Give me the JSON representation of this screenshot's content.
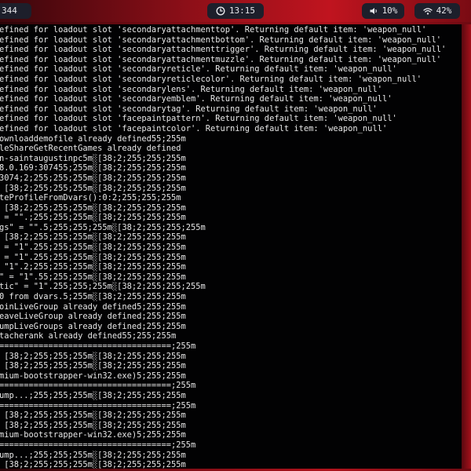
{
  "statusbar": {
    "workspace_label": "344",
    "clock_text": "13:15",
    "battery_text": "10%",
    "wifi_text": "42%",
    "icons": {
      "clock": "clock-icon",
      "battery": "speaker-icon",
      "wifi": "wifi-icon"
    },
    "colors": {
      "bar_red": "#b0121c",
      "pill_bg": "#1d1f2b",
      "terminal_bg": "#020203",
      "terminal_fg": "#e8e8e8"
    }
  },
  "terminal": {
    "lines": [
      "efined for loadout slot 'secondaryattachmenttop'. Returning default item: 'weapon_null'",
      "efined for loadout slot 'secondaryattachmentbottom'. Returning default item: 'weapon_null'",
      "efined for loadout slot 'secondaryattachmenttrigger'. Returning default item: 'weapon_null'",
      "efined for loadout slot 'secondaryattachmentmuzzle'. Returning default item: 'weapon_null'",
      "efined for loadout slot 'secondaryreticle'. Returning default item: 'weapon_null'",
      "efined for loadout slot 'secondaryreticlecolor'. Returning default item: 'weapon_null'",
      "efined for loadout slot 'secondarylens'. Returning default item: 'weapon_null'",
      "efined for loadout slot 'secondaryemblem'. Returning default item: 'weapon_null'",
      "efined for loadout slot 'secondarytag'. Returning default item: 'weapon_null'",
      "efined for loadout slot 'facepaintpattern'. Returning default item: 'weapon_null'",
      "efined for loadout slot 'facepaintcolor'. Returning default item: 'weapon_null'",
      "ownloaddemofile already defined55;255m",
      "leShareGetRecentGames already defined",
      "n-saintaugustinpc5m░[38;2;255;255;255m",
      "8.0.169:307455;255m░[38;2;255;255;255m",
      "3074;2;255;255;255m░[38;2;255;255;255m",
      " [38;2;255;255;255m░[38;2;255;255;255m",
      "teProfileFromDvars():0:2;255;255;255m",
      " [38;2;255;255;255m░[38;2;255;255;255m",
      " = \"\".;255;255;255m░[38;2;255;255;255m",
      "gs\" = \"\".5;255;255;255m░[38;2;255;255;255m",
      " [38;2;255;255;255m░[38;2;255;255;255m",
      " = \"1\".255;255;255m░[38;2;255;255;255m",
      " = \"1\".255;255;255m░[38;2;255;255;255m",
      " \"1\".2;255;255;255m░[38;2;255;255;255m",
      "\" = \"1\".55;255;255m░[38;2;255;255;255m",
      "tic\" = \"1\".255;255;255m░[38;2;255;255;255m",
      "0 from dvars.5;255m░[38;2;255;255;255m",
      "oinLiveGroup already defined5;255;255m",
      "eaveLiveGroup already defined;255;255m",
      "umpLiveGroups already defined;255;255m",
      "tacherank already defined55;255;255m",
      "===================================;255m",
      " [38;2;255;255;255m░[38;2;255;255;255m",
      " [38;2;255;255;255m░[38;2;255;255;255m",
      "mium-bootstrapper-win32.exe)5;255;255m",
      "===================================;255m",
      "ump...;255;255;255m░[38;2;255;255;255m",
      "===================================;255m",
      " [38;2;255;255;255m░[38;2;255;255;255m",
      " [38;2;255;255;255m░[38;2;255;255;255m",
      "mium-bootstrapper-win32.exe)5;255;255m",
      "===================================;255m",
      "ump...;255;255;255m░[38;2;255;255;255m",
      " [38;2;255;255;255m░[38;2;255;255;255m"
    ]
  }
}
